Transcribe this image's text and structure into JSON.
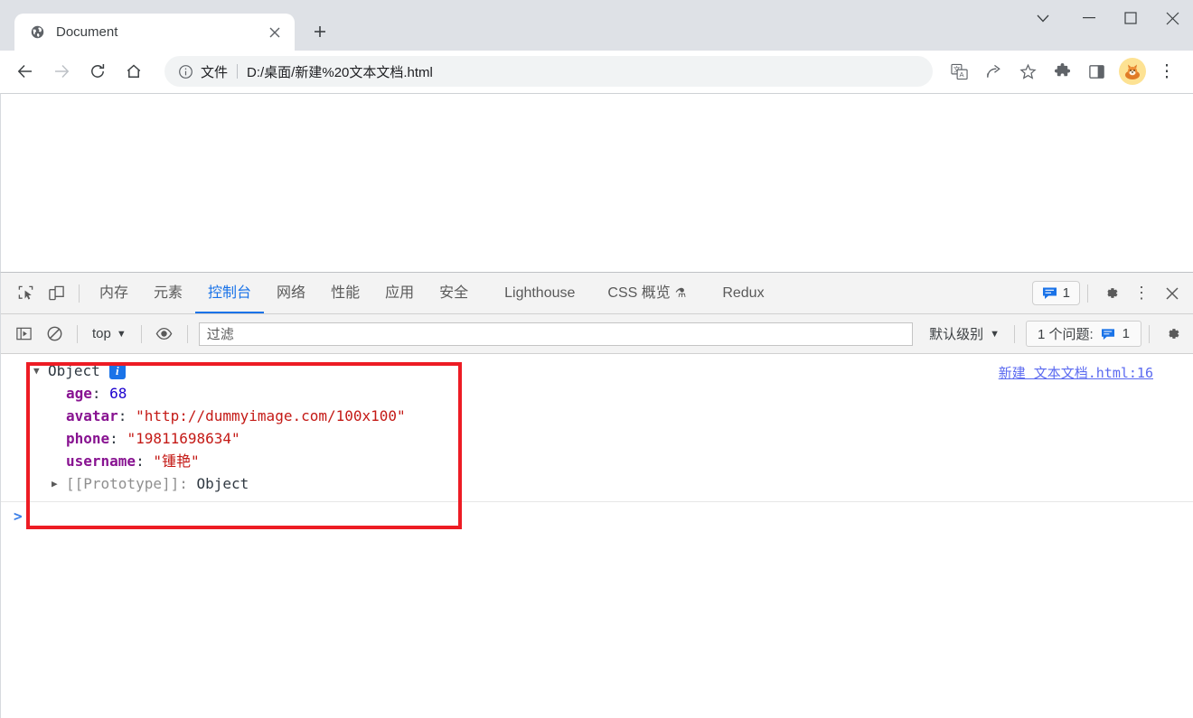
{
  "window": {
    "controls": [
      {
        "name": "tab-search-button",
        "glyph": "chevron-down"
      },
      {
        "name": "minimize-button",
        "glyph": "minimize"
      },
      {
        "name": "maximize-button",
        "glyph": "maximize"
      },
      {
        "name": "close-button",
        "glyph": "close"
      }
    ]
  },
  "tabstrip": {
    "tab": {
      "title": "Document",
      "favicon": "globe-icon",
      "close_label": "×"
    },
    "new_tab_label": "+"
  },
  "toolbar": {
    "back_label": "←",
    "forward_label": "→",
    "reload_label": "⟳",
    "home_label": "⌂",
    "omnibox": {
      "info_icon": "info-circle-icon",
      "scheme_label": "文件",
      "url": "D:/桌面/新建%20文本文档.html"
    },
    "right_icons": [
      {
        "name": "translate-icon",
        "title": "翻译"
      },
      {
        "name": "share-icon",
        "title": "分享"
      },
      {
        "name": "bookmark-star-icon",
        "title": "收藏"
      },
      {
        "name": "extensions-puzzle-icon",
        "title": "扩展程序"
      },
      {
        "name": "side-panel-icon",
        "title": "侧边栏"
      }
    ],
    "avatar_name": "profile-avatar",
    "menu_label": "⋮"
  },
  "devtools": {
    "left_tools": [
      {
        "name": "inspect-element-icon"
      },
      {
        "name": "device-toolbar-icon"
      }
    ],
    "tabs": [
      {
        "label": "内存",
        "active": false
      },
      {
        "label": "元素",
        "active": false
      },
      {
        "label": "控制台",
        "active": true
      },
      {
        "label": "网络",
        "active": false
      },
      {
        "label": "性能",
        "active": false
      },
      {
        "label": "应用",
        "active": false
      },
      {
        "label": "安全",
        "active": false
      },
      {
        "label": "Lighthouse",
        "active": false
      },
      {
        "label": "CSS 概览",
        "active": false,
        "flask": "⚗"
      },
      {
        "label": "Redux",
        "active": false
      }
    ],
    "messages_badge": "1",
    "settings_label": "gear-icon",
    "more_label": "⋮",
    "close_label": "✕",
    "console_toolbar": {
      "sidebar_toggle": "console-sidebar-icon",
      "clear_label": "clear-console-icon",
      "context": "top",
      "context_caret": "▼",
      "eye_label": "live-expression-icon",
      "filter_placeholder": "过滤",
      "level": "默认级别",
      "level_caret": "▼",
      "issues_text": "1 个问题:",
      "issues_count": "1",
      "settings_label": "gear-icon"
    }
  },
  "console": {
    "source_link": "新建 文本文档.html:16",
    "object": {
      "toggle": "▼",
      "label": "Object",
      "info_badge": "i",
      "properties": [
        {
          "key": "age",
          "value": "68",
          "type": "number"
        },
        {
          "key": "avatar",
          "value": "\"http://dummyimage.com/100x100\"",
          "type": "string"
        },
        {
          "key": "phone",
          "value": "\"19811698634\"",
          "type": "string"
        },
        {
          "key": "username",
          "value": "\"锺艳\"",
          "type": "string"
        }
      ],
      "prototype": {
        "toggle": "▶",
        "key": "[[Prototype]]",
        "value": "Object"
      }
    },
    "prompt": ">"
  },
  "colors": {
    "accent": "#1a73e8",
    "annotation": "#ed1c24",
    "key": "#881391",
    "string": "#c41a16",
    "number": "#1c00cf",
    "link": "#5b6af0"
  }
}
